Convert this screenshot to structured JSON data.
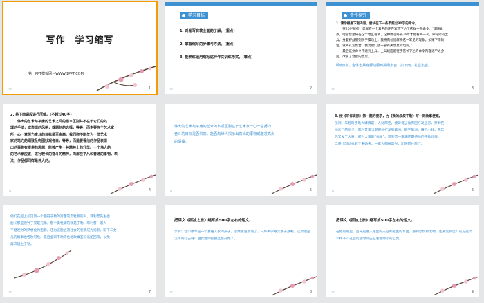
{
  "slides": [
    {
      "num": "1",
      "star": "☆",
      "title": "写作　学习缩写",
      "subtitle": "第一PPT模板网－WWW.1PPT.COM"
    },
    {
      "num": "2",
      "star": "☆",
      "tag": "学习目标",
      "lines": [
        "1. 对缩写有较全面的了解。(重点)",
        "2. 掌握缩写的步骤与方法。(重点)",
        "3. 能熟练运用缩写这种作文训练形式。(难点)"
      ]
    },
    {
      "num": "3",
      "star": "☆",
      "tag": "合作探究",
      "lines": [
        "1. 请你根据下面内容，尝试在下一条不超过30字的命令。",
        "　　在20世纪初，美军有一个着名的连在军营下达了这样一条命令：“明晚8",
        "点，哈雷彗星将在这个地区看到，这种情况每隔76年才能看到一次。命令所有士",
        "兵，身着野战服列队于操场上，我将向他们解释这一罕见的现象。如果下雨的",
        "话，就到礼堂集合，我为他们放一部有关彗星的电影。”",
        "　　最后这条命令传递到士兵，士兵班面前在于营长下达的命令内容记不太多",
        "变，改变了彗星的意思。"
      ],
      "answer": "明晚8点，全体士兵穿野战服到操场集合，如下雨，礼堂集合。"
    },
    {
      "num": "4",
      "star": "☆",
      "lines": [
        "2. 将下面语段进行压缩。(不超过40字)",
        "　　伟大的艺术与平庸的艺术之间的根本区别并不在于它们的处",
        "理的手法，或表现的风格，或题材的选择，等等，而主要在于艺术家",
        "所一心一意努力奋斗的目标是否崇高。我们称不能仅为一位艺术",
        "家的笔力的细致及构图妙观者目，等等，而是要看他的作品表现",
        "出的事物有提供的思想，能够产生一种精神上的升华。一个伟大的",
        "的艺术家应该，进行较长的奋斗的精神，向那些平凡和普通的事物，表",
        "法，作品都同样是伟大的。"
      ]
    },
    {
      "num": "5",
      "star": "☆",
      "lines": [
        "伟大的艺术与平庸的艺术的本质区别在于艺术家一心一意努力",
        "奋斗的目标是否崇高，能否向世人揭示出高尚的事物或激发高尚",
        "的情操。"
      ]
    },
    {
      "num": "6",
      "star": "☆",
      "lines": [
        "3. 按《写作实际》第一题的要求，为《我的叔叔于勒》写一则故事梗概。",
        "示例：年轻时于勒大肆挥霍，人财两空，被哥哥当做穷困打发远方，弃到在",
        "地出门的地步。菲利普家当即把他打发到美洲。既至美洲，赚了小钱，两年",
        "后又发了大财，成为大家的“福星”。菲利普一家满怀期待他的于勒归来。",
        "二姐也因此找到了未婚夫，一家人都很高兴，出国前往旅行。"
      ]
    },
    {
      "num": "7",
      "star": "☆",
      "lines": [
        "他们在船上却见到一个服役于勒的穷苦的卖牡蛎的人，菲利普先生也",
        "能长那是撞钟于某是兄弟，那个卖牡蛎的就是于勒。菲利普一家人",
        "不但发财的梦想化为泡影，还为逃脱之流社会的羡慕成为泡影，眼下二女",
        "儿的婚事也告吹可危。最后全家不动声色地改乘圣玛洛船回来，以免",
        "再次碰上于勒。"
      ]
    },
    {
      "num": "8",
      "star": "☆",
      "lines": [
        "把课文《孤独之旅》缩写成500字左右的短文。"
      ],
      "answer": "示例：杜小康本是一个富裕人家的孩子，忽然家道衰落了，只好失学跟父亲去放鸭，这对他是怎样的打击呀！由此他的孤独之旅开始了。"
    },
    {
      "num": "9",
      "star": "☆",
      "lines": [
        "把课文《孤独之旅》缩写成500字左右的短文。"
      ],
      "answer": "在他的眼里，首先是进入陌生的天空和陌生的水面，感到恐惧和无助，还要走多远？前方是什么样子？这些问题时刻压迫着他幼小的心灵。"
    }
  ]
}
